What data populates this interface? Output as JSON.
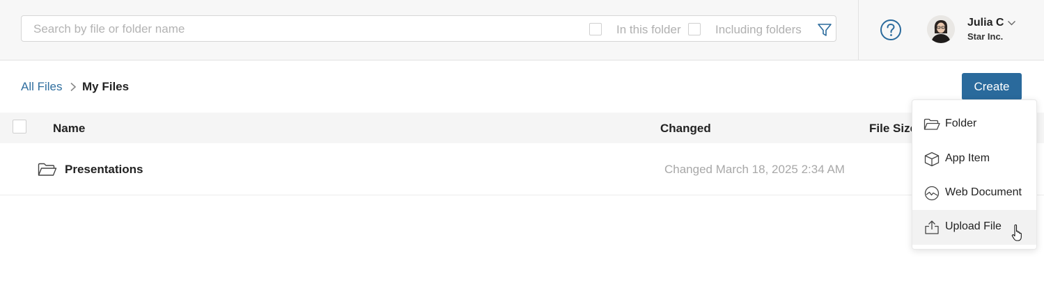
{
  "header": {
    "search": {
      "placeholder": "Search by file or folder name",
      "in_this_folder_label": "In this folder",
      "in_this_folder_checked": false,
      "including_folders_label": "Including folders",
      "including_folders_checked": false,
      "filter_icon": "filter-icon"
    },
    "help_icon": "help-circle-icon",
    "user": {
      "name": "Julia C",
      "org": "Star Inc."
    }
  },
  "breadcrumb": {
    "root": "All Files",
    "current": "My Files"
  },
  "toolbar": {
    "create_label": "Create"
  },
  "table": {
    "columns": [
      "Name",
      "Changed",
      "File Size"
    ],
    "rows": [
      {
        "icon": "folder-icon",
        "name": "Presentations",
        "changed": "Changed March 18, 2025 2:34 AM"
      }
    ]
  },
  "create_menu": {
    "items": [
      {
        "icon": "folder-icon",
        "label": "Folder"
      },
      {
        "icon": "cube-icon",
        "label": "App Item"
      },
      {
        "icon": "web-document-icon",
        "label": "Web Document"
      },
      {
        "icon": "upload-icon",
        "label": "Upload File"
      }
    ],
    "hovered_index": 3
  },
  "colors": {
    "accent": "#2a6a9c",
    "link": "#2f6e9f",
    "header_bg": "#f7f7f7",
    "muted_text": "#a8a8a8"
  }
}
